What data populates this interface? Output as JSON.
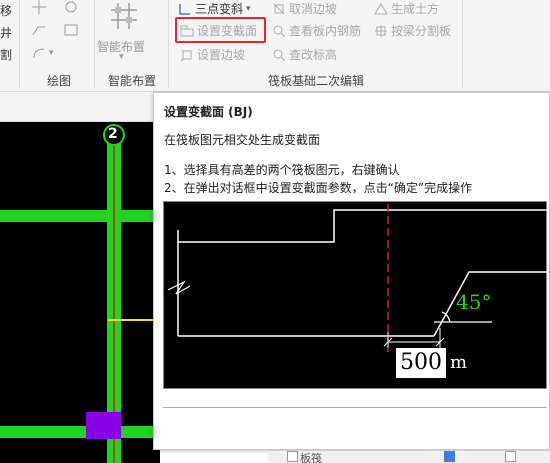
{
  "ribbon": {
    "left_partial": [
      "移",
      "井",
      "割"
    ],
    "draw_group_label": "绘图",
    "smart_layout_button": "智能布置",
    "smart_layout_group_label": "智能布置",
    "slab_group_label": "筏板基础二次编辑",
    "items": {
      "three_point_slope": "三点变斜",
      "set_section_change": "设置变截面",
      "set_edge_slope": "设置边坡",
      "cancel_edge_slope": "取消边坡",
      "view_slab_rebar": "查看板内钢筋",
      "check_elevation": "查改标高",
      "generate_earthwork": "生成土方",
      "split_by_beam": "按梁分割板"
    }
  },
  "canvas": {
    "axis_label": "2"
  },
  "tooltip": {
    "title": "设置变截面 (BJ)",
    "description": "在筏板图元相交处生成变截面",
    "step1": "1、选择具有高差的两个筏板图元，右键确认",
    "step2": "2、在弹出对话框中设置变截面参数，点击“确定”完成操作",
    "diagram": {
      "angle_label": "45°",
      "dimension_value": "500",
      "dimension_unit": "m"
    }
  },
  "bottom_right": {
    "partial_text": "板筏"
  },
  "colors": {
    "highlight": "#e8252b",
    "grid_green": "#22d322",
    "axis_red": "#d42020",
    "purple": "#8a00e6",
    "angle_text": "#1ed41e"
  }
}
